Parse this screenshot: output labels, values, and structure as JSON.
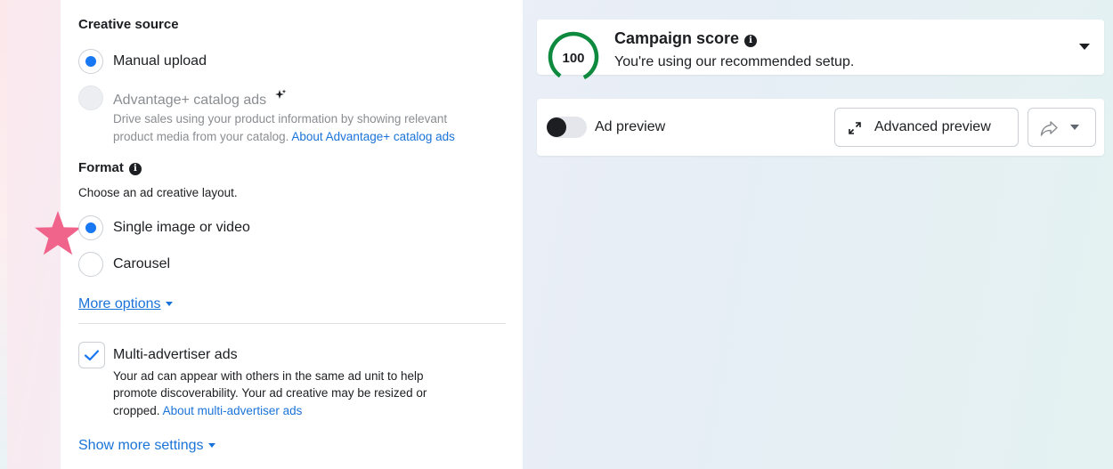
{
  "creative_source": {
    "title": "Creative source",
    "options": [
      {
        "label": "Manual upload",
        "checked": true,
        "disabled": false
      },
      {
        "label": "Advantage+ catalog ads",
        "checked": false,
        "disabled": true,
        "desc_line1": "Drive sales using your product information by showing relevant",
        "desc_line2": "product media from your catalog.",
        "link": "About Advantage+ catalog ads"
      }
    ]
  },
  "format": {
    "title": "Format",
    "subtitle": "Choose an ad creative layout.",
    "options": [
      {
        "label": "Single image or video",
        "checked": true
      },
      {
        "label": "Carousel",
        "checked": false
      }
    ],
    "more_options": "More options"
  },
  "multi_advertiser": {
    "label": "Multi-advertiser ads",
    "checked": true,
    "desc_line1": "Your ad can appear with others in the same ad unit to help",
    "desc_line2": "promote discoverability. Your ad creative may be resized or",
    "desc_line3": "cropped.",
    "link": "About multi-advertiser ads"
  },
  "show_more_settings": "Show more settings",
  "campaign_score": {
    "score": "100",
    "score_fraction": 1.0,
    "title": "Campaign score",
    "subtitle": "You're using our recommended setup."
  },
  "ad_preview": {
    "toggle_label": "Ad preview",
    "toggle_on": false,
    "advanced_preview_label": "Advanced preview"
  },
  "colors": {
    "accent_blue": "#1877f2",
    "link_blue": "#1a73d8",
    "score_green": "#0e8a3e",
    "star_pink": "#f0648c"
  },
  "icons": {
    "info": "info-icon",
    "sparkle": "sparkle-icon",
    "expand": "expand-arrows-icon",
    "share": "share-arrow-icon",
    "star": "star-icon"
  }
}
